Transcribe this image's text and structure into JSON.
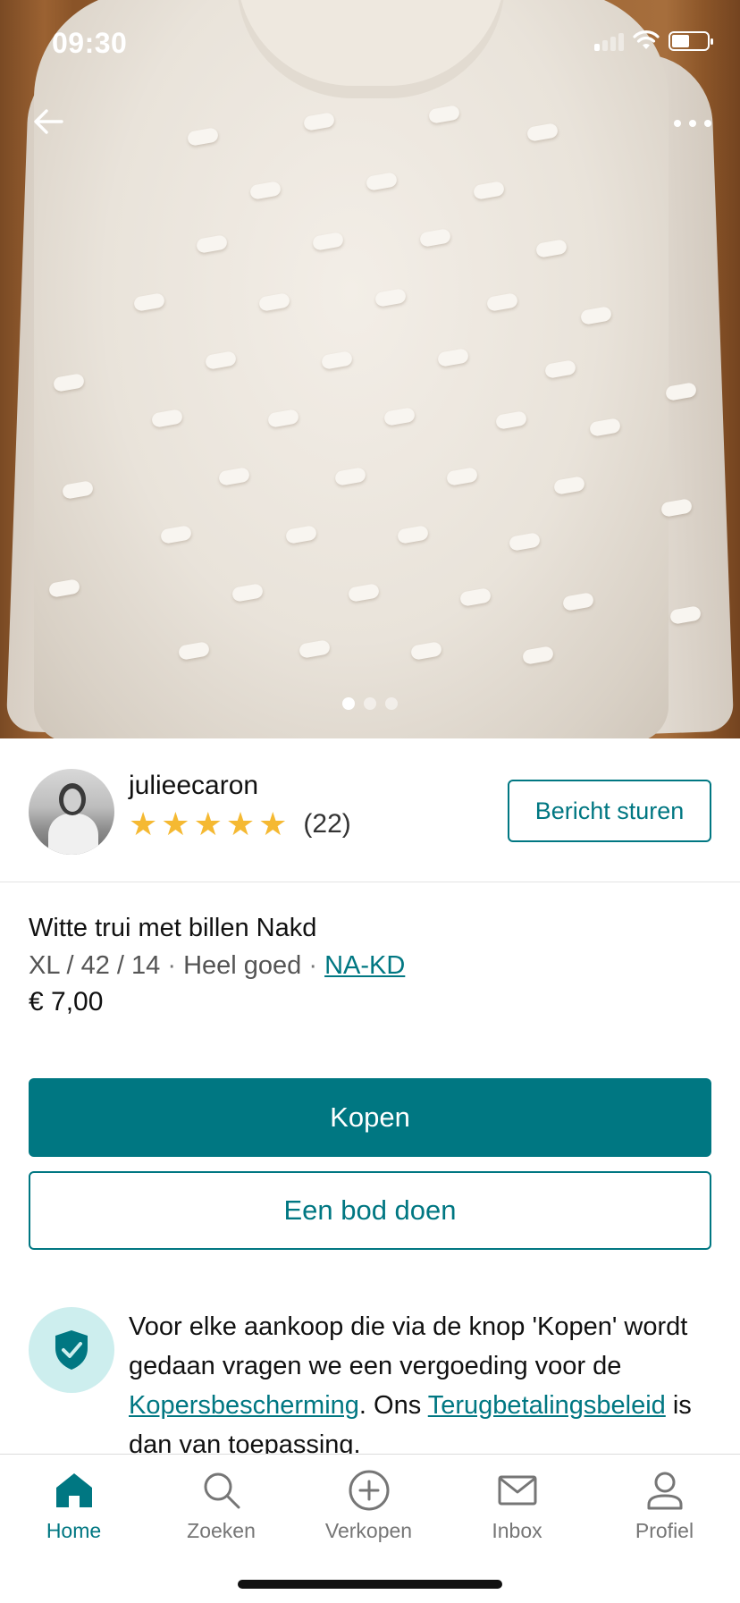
{
  "status_bar": {
    "time": "09:30",
    "battery_level": 0.5
  },
  "photo": {
    "back_icon": "arrow-left-icon",
    "more_icon": "more-horizontal-icon",
    "page_count": 3,
    "current_page": 1
  },
  "seller": {
    "username": "julieecaron",
    "rating_stars": 5,
    "review_count": "(22)",
    "message_button": "Bericht sturen"
  },
  "item": {
    "title": "Witte trui met billen Nakd",
    "size": "XL / 42 / 14",
    "separator": "·",
    "condition": "Heel goed",
    "brand": "NA-KD",
    "price": "€ 7,00"
  },
  "actions": {
    "buy": "Kopen",
    "offer": "Een bod doen"
  },
  "protection": {
    "icon": "shield-check-icon",
    "text_1": "Voor elke aankoop die via de knop 'Kopen' wordt gedaan vragen we een vergoeding voor de ",
    "link_1": "Kopersbescherming",
    "text_2": ". Ons ",
    "link_2": "Terugbetalingsbeleid",
    "text_3": " is dan van toepassing."
  },
  "tabbar": {
    "tabs": [
      {
        "label": "Home",
        "icon": "home-icon",
        "active": true
      },
      {
        "label": "Zoeken",
        "icon": "search-icon",
        "active": false
      },
      {
        "label": "Verkopen",
        "icon": "plus-circle-icon",
        "active": false
      },
      {
        "label": "Inbox",
        "icon": "mail-icon",
        "active": false
      },
      {
        "label": "Profiel",
        "icon": "user-icon",
        "active": false
      }
    ]
  },
  "colors": {
    "accent": "#007782",
    "star": "#f5b932",
    "shield_bg": "#cdeeee"
  }
}
